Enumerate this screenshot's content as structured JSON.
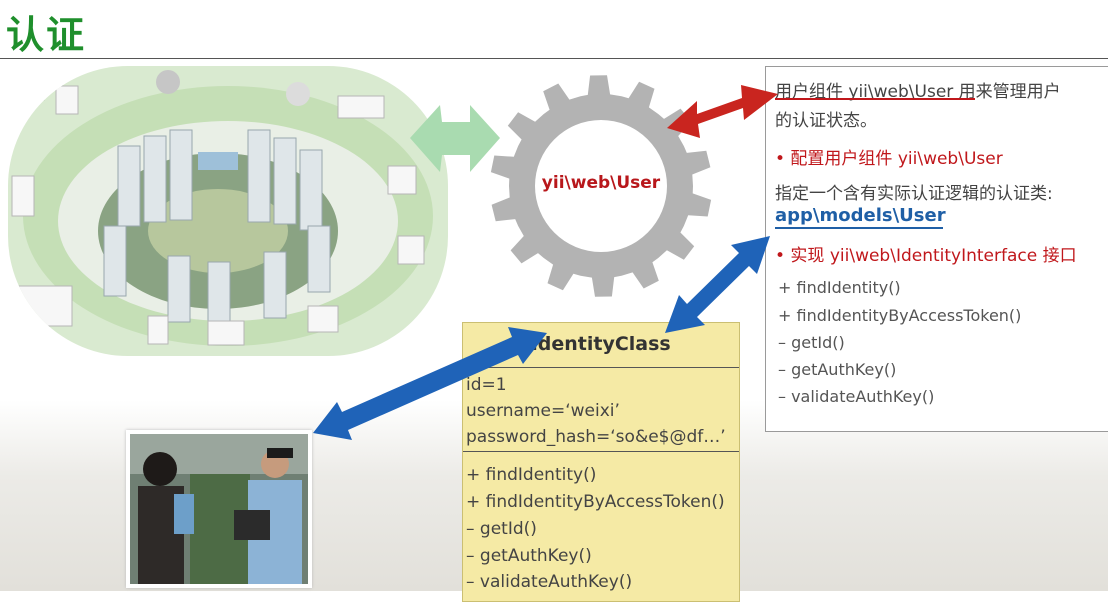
{
  "title": "认证",
  "gear": {
    "label": "yii\\web\\User"
  },
  "info": {
    "line1": "用户组件 yii\\web\\User 用来管理用户",
    "line2": "的认证状态。",
    "bullet1": "• 配置用户组件 yii\\web\\User",
    "line3": "指定一个含有实际认证逻辑的认证类:",
    "line4": "app\\models\\User",
    "bullet2": "• 实现 yii\\web\\IdentityInterface 接口",
    "methods": [
      "+ findIdentity()",
      "+ findIdentityByAccessToken()",
      "– getId()",
      "– getAuthKey()",
      "– validateAuthKey()"
    ]
  },
  "identity_class": {
    "title": "identityClass",
    "fields": [
      "id=1",
      "username=‘weixi’",
      "password_hash=‘so&e$@df…’"
    ],
    "methods": [
      "+ findIdentity()",
      "+ findIdentityByAccessToken()",
      "– getId()",
      "– getAuthKey()",
      "– validateAuthKey()"
    ]
  },
  "colors": {
    "title": "#1f8f2c",
    "gear": "#b3b3b3",
    "red_arrow": "#c9251f",
    "blue_arrow": "#1f63b8",
    "green_arrow": "#a9dbb0",
    "class_box": "#f5eaa5"
  }
}
